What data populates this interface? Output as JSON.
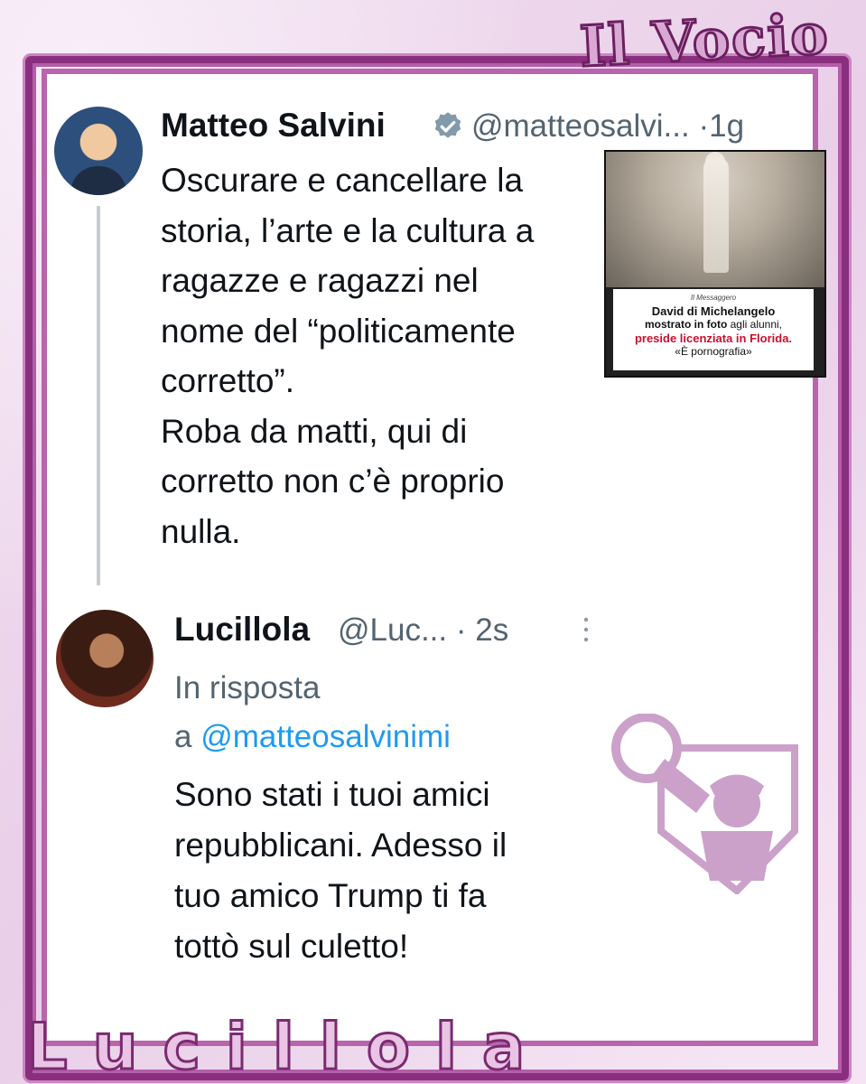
{
  "brand": {
    "title": "Il Vocio"
  },
  "tweet1": {
    "author_name": "Matteo Salvini",
    "handle": "@matteosalvi...",
    "separator": "·",
    "time": "1g",
    "text": "Oscurare e cancellare la\nstoria, l’arte e la cultura a\nragazze e ragazzi nel\nnome del “politicamente\ncorretto”.\nRoba da matti, qui di\ncorretto non c’è proprio\nnulla.",
    "verified_icon": "verified-badge-icon",
    "media": {
      "source": "Il Messaggero",
      "line1": "David di Michelangelo",
      "line2_bold": "mostrato in foto",
      "line2_rest": " agli alunni,",
      "line3": "preside licenziata in Florida.",
      "line4": "«È pornografia»",
      "highlight_color": "#c8102e"
    }
  },
  "tweet2": {
    "author_name": "Lucillola",
    "handle": "@Luc...",
    "separator": "·",
    "time": "2s",
    "reply_prefix": "In risposta\na ",
    "reply_handle": "@matteosalvinimi",
    "text": "Sono stati i tuoi amici\nrepubblicani. Adesso il\ntuo amico Trump ti fa\ntottò sul culetto!",
    "more_icon": "more-vertical-icon"
  },
  "footer": {
    "brand": "Lucillola"
  },
  "colors": {
    "frame": "#8a2f7e",
    "link": "#1d9bf0",
    "muted": "#536471",
    "text": "#0f1419"
  }
}
